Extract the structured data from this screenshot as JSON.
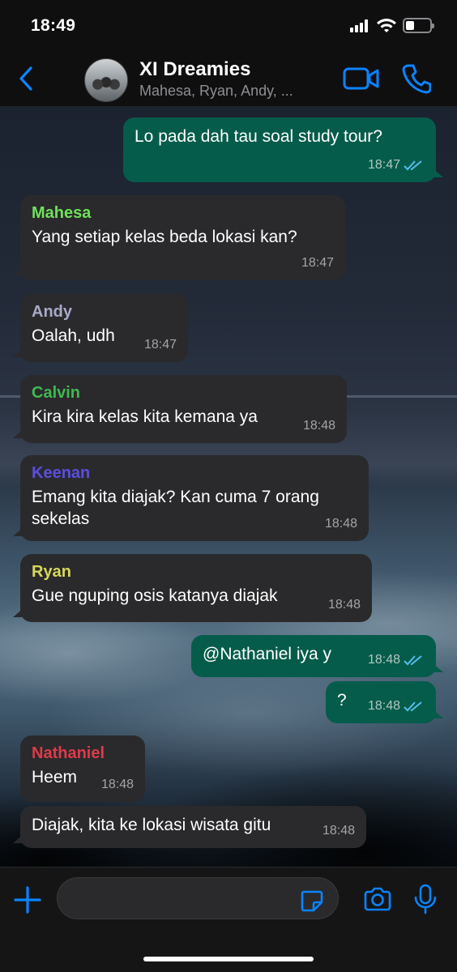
{
  "status_bar": {
    "time": "18:49"
  },
  "header": {
    "title": "XI Dreamies",
    "subtitle": "Mahesa, Ryan, Andy, ..."
  },
  "colors": {
    "accent": "#0a84ff",
    "outgoing_bubble": "#055c4b",
    "incoming_bubble": "#2a2a2c",
    "read_ticks": "#53bdeb"
  },
  "messages": [
    {
      "direction": "out",
      "text": "Lo pada dah tau soal study tour?",
      "time": "18:47",
      "status": "read"
    },
    {
      "direction": "in",
      "sender": "Mahesa",
      "sender_color": "#6ee25a",
      "text": "Yang setiap kelas beda lokasi kan?",
      "time": "18:47"
    },
    {
      "direction": "in",
      "sender": "Andy",
      "sender_color": "#a8a9c8",
      "text": "Oalah, udh",
      "time": "18:47"
    },
    {
      "direction": "in",
      "sender": "Calvin",
      "sender_color": "#3fb950",
      "text": "Kira kira kelas kita kemana ya",
      "time": "18:48"
    },
    {
      "direction": "in",
      "sender": "Keenan",
      "sender_color": "#5b4ee0",
      "text": "Emang kita diajak? Kan cuma 7 orang sekelas",
      "time": "18:48"
    },
    {
      "direction": "in",
      "sender": "Ryan",
      "sender_color": "#d8d85a",
      "text": "Gue nguping osis katanya diajak",
      "time": "18:48"
    },
    {
      "direction": "out",
      "text": "@Nathaniel iya y",
      "time": "18:48",
      "status": "read"
    },
    {
      "direction": "out",
      "text": "?",
      "time": "18:48",
      "status": "read"
    },
    {
      "direction": "in",
      "sender": "Nathaniel",
      "sender_color": "#e03a4a",
      "text": "Heem",
      "time": "18:48"
    },
    {
      "direction": "in",
      "text": "Diajak, kita ke lokasi wisata gitu",
      "time": "18:48"
    }
  ],
  "composer": {
    "icons": [
      "plus-icon",
      "sticker-icon",
      "camera-icon",
      "mic-icon"
    ]
  }
}
